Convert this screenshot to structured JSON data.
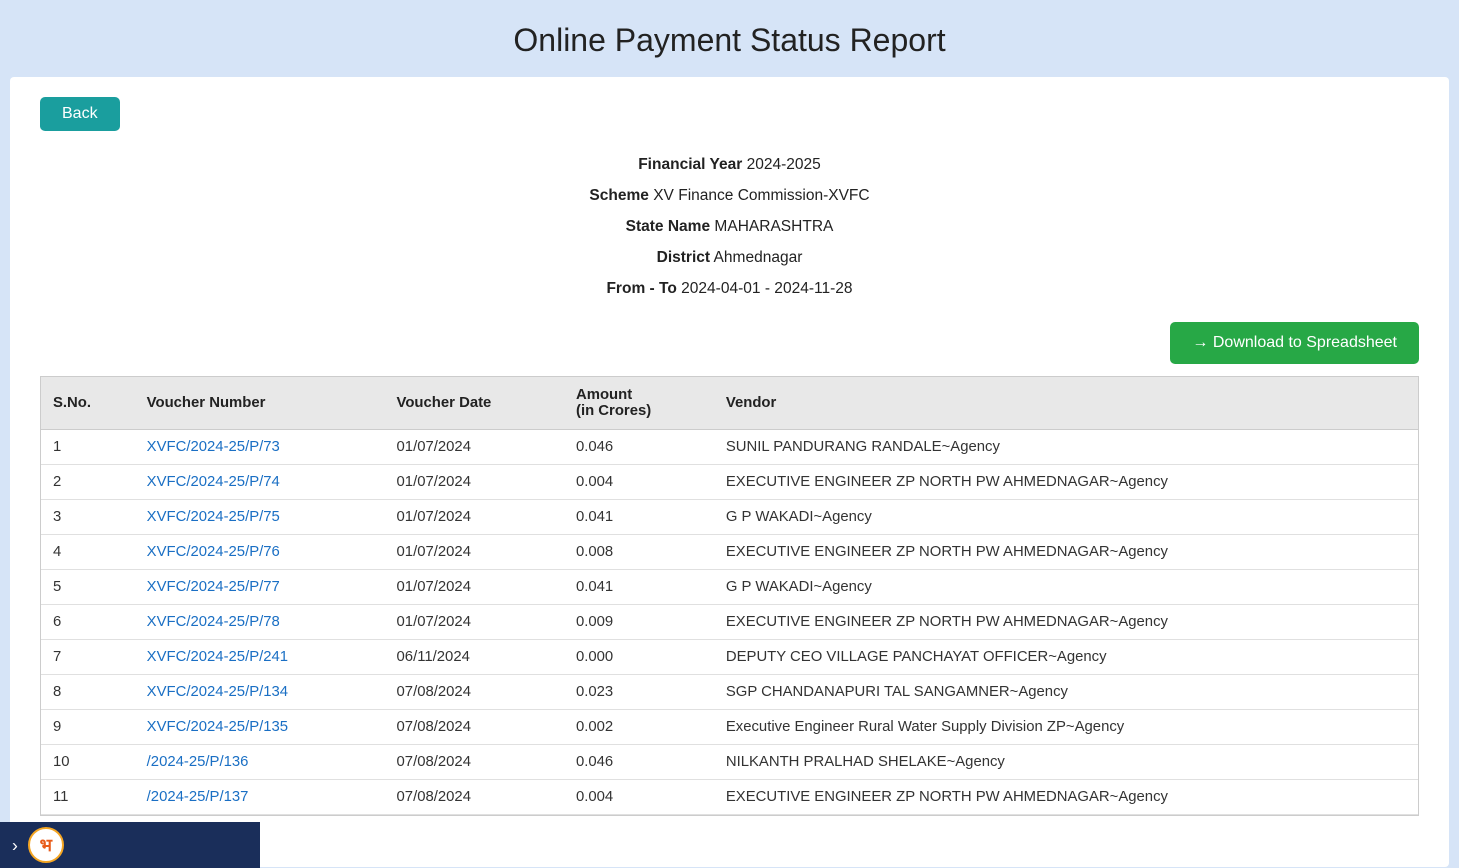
{
  "page": {
    "title": "Online Payment Status Report",
    "back_label": "Back",
    "download_label": "→ Download to Spreadsheet"
  },
  "info": {
    "financial_year_label": "Financial Year",
    "financial_year_value": "2024-2025",
    "scheme_label": "Scheme",
    "scheme_value": "XV Finance Commission-XVFC",
    "state_label": "State Name",
    "state_value": "MAHARASHTRA",
    "district_label": "District",
    "district_value": "Ahmednagar",
    "from_to_label": "From - To",
    "from_to_value": "2024-04-01 - 2024-11-28"
  },
  "table": {
    "headers": [
      "S.No.",
      "Voucher Number",
      "Voucher Date",
      "Amount\n(in Crores)",
      "Vendor"
    ],
    "rows": [
      {
        "sno": "1",
        "voucher": "XVFC/2024-25/P/73",
        "date": "01/07/2024",
        "amount": "0.046",
        "vendor": "SUNIL PANDURANG RANDALE~Agency"
      },
      {
        "sno": "2",
        "voucher": "XVFC/2024-25/P/74",
        "date": "01/07/2024",
        "amount": "0.004",
        "vendor": "EXECUTIVE ENGINEER ZP NORTH PW AHMEDNAGAR~Agency"
      },
      {
        "sno": "3",
        "voucher": "XVFC/2024-25/P/75",
        "date": "01/07/2024",
        "amount": "0.041",
        "vendor": "G P WAKADI~Agency"
      },
      {
        "sno": "4",
        "voucher": "XVFC/2024-25/P/76",
        "date": "01/07/2024",
        "amount": "0.008",
        "vendor": "EXECUTIVE ENGINEER ZP NORTH PW AHMEDNAGAR~Agency"
      },
      {
        "sno": "5",
        "voucher": "XVFC/2024-25/P/77",
        "date": "01/07/2024",
        "amount": "0.041",
        "vendor": "G P WAKADI~Agency"
      },
      {
        "sno": "6",
        "voucher": "XVFC/2024-25/P/78",
        "date": "01/07/2024",
        "amount": "0.009",
        "vendor": "EXECUTIVE ENGINEER ZP NORTH PW AHMEDNAGAR~Agency"
      },
      {
        "sno": "7",
        "voucher": "XVFC/2024-25/P/241",
        "date": "06/11/2024",
        "amount": "0.000",
        "vendor": "DEPUTY CEO VILLAGE PANCHAYAT OFFICER~Agency"
      },
      {
        "sno": "8",
        "voucher": "XVFC/2024-25/P/134",
        "date": "07/08/2024",
        "amount": "0.023",
        "vendor": "SGP CHANDANAPURI TAL SANGAMNER~Agency"
      },
      {
        "sno": "9",
        "voucher": "XVFC/2024-25/P/135",
        "date": "07/08/2024",
        "amount": "0.002",
        "vendor": "Executive Engineer Rural Water Supply Division ZP~Agency"
      },
      {
        "sno": "10",
        "voucher": "/2024-25/P/136",
        "date": "07/08/2024",
        "amount": "0.046",
        "vendor": "NILKANTH PRALHAD SHELAKE~Agency"
      },
      {
        "sno": "11",
        "voucher": "/2024-25/P/137",
        "date": "07/08/2024",
        "amount": "0.004",
        "vendor": "EXECUTIVE ENGINEER ZP NORTH PW AHMEDNAGAR~Agency"
      }
    ]
  }
}
